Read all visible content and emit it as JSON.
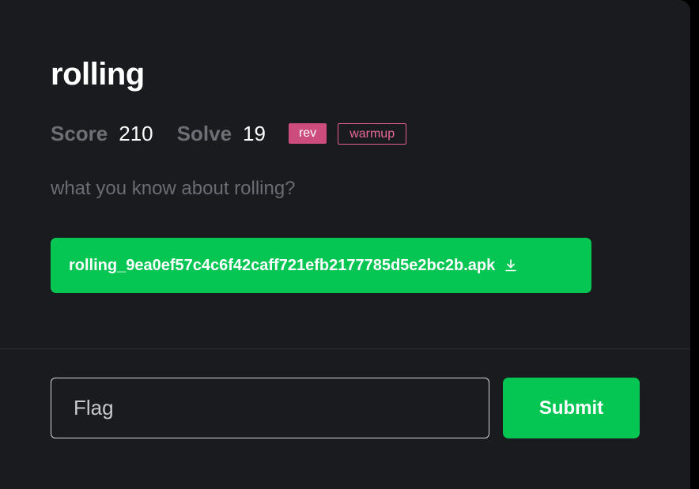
{
  "challenge": {
    "title": "rolling",
    "score_label": "Score",
    "score_value": "210",
    "solve_label": "Solve",
    "solve_value": "19",
    "tags": [
      "rev",
      "warmup"
    ],
    "description": "what you know about rolling?",
    "attachment": {
      "filename": "rolling_9ea0ef57c4c6f42caff721efb2177785d5e2bc2b.apk",
      "icon": "download-icon"
    }
  },
  "flag_form": {
    "placeholder": "Flag",
    "value": "",
    "submit_label": "Submit"
  },
  "colors": {
    "panel_background": "#1a1b1e",
    "accent_green": "#05c653",
    "tag_rev": "#cc4c7d",
    "tag_warmup": "#e0608e",
    "muted_text": "#6e6f76"
  }
}
